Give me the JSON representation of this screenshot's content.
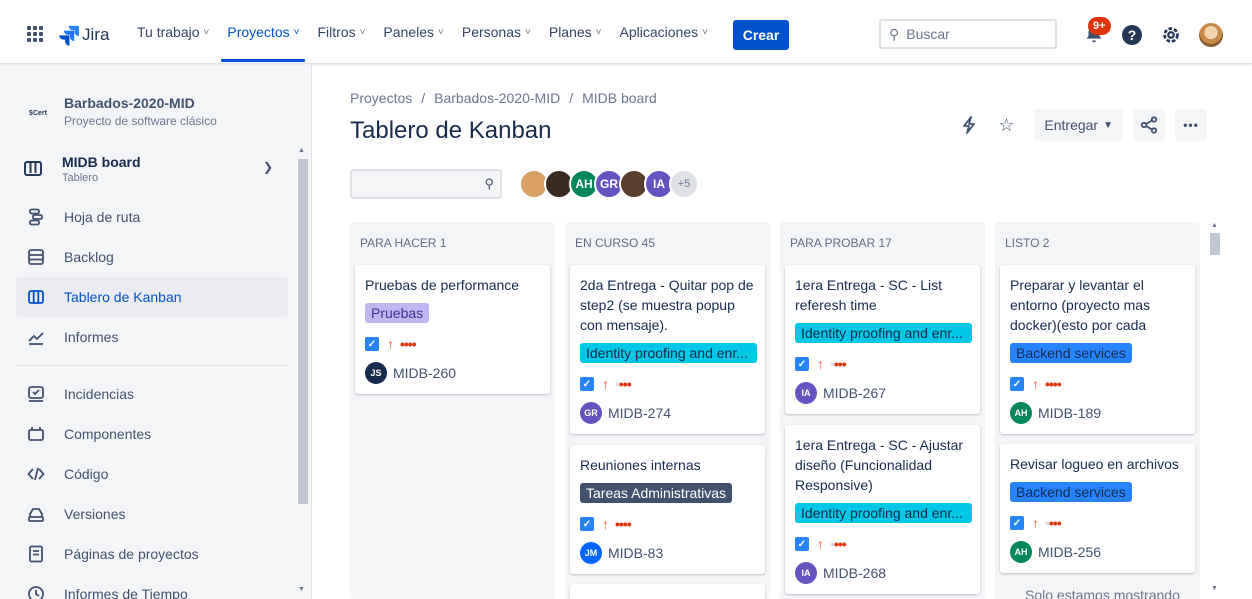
{
  "nav": {
    "logo_text": "Jira",
    "items": [
      {
        "label": "Tu trabajo"
      },
      {
        "label": "Proyectos",
        "active": true
      },
      {
        "label": "Filtros"
      },
      {
        "label": "Paneles"
      },
      {
        "label": "Personas"
      },
      {
        "label": "Planes"
      },
      {
        "label": "Aplicaciones"
      }
    ],
    "create_label": "Crear",
    "search_placeholder": "Buscar",
    "notifications_badge": "9+",
    "help_label": "?"
  },
  "sidebar": {
    "project_logo": "$Cert",
    "project_name": "Barbados-2020-MID",
    "project_type": "Proyecto de software clásico",
    "board_name": "MIDB board",
    "board_type": "Tablero",
    "items_top": [
      {
        "label": "Hoja de ruta",
        "icon": "roadmap-icon"
      },
      {
        "label": "Backlog",
        "icon": "backlog-icon"
      },
      {
        "label": "Tablero de Kanban",
        "icon": "board-icon",
        "active": true
      },
      {
        "label": "Informes",
        "icon": "reports-icon"
      }
    ],
    "items_bottom": [
      {
        "label": "Incidencias",
        "icon": "issues-icon"
      },
      {
        "label": "Componentes",
        "icon": "components-icon"
      },
      {
        "label": "Código",
        "icon": "code-icon"
      },
      {
        "label": "Versiones",
        "icon": "releases-icon"
      },
      {
        "label": "Páginas de proyectos",
        "icon": "pages-icon"
      },
      {
        "label": "Informes de Tiempo",
        "icon": "time-icon"
      }
    ]
  },
  "main": {
    "breadcrumb": [
      "Proyectos",
      "Barbados-2020-MID",
      "MIDB board"
    ],
    "title": "Tablero de Kanban",
    "entregar_label": "Entregar",
    "more_label": "•••",
    "avatars": [
      {
        "initials": "",
        "color": "#d9a066"
      },
      {
        "initials": "",
        "color": "#3b2a20"
      },
      {
        "initials": "AH",
        "color": "#00875a"
      },
      {
        "initials": "GR",
        "color": "#6554c0"
      },
      {
        "initials": "",
        "color": "#5a3d2b"
      },
      {
        "initials": "IA",
        "color": "#6554c0"
      },
      {
        "initials": "+5",
        "color": "#dfe1e6"
      }
    ]
  },
  "board": {
    "columns": [
      {
        "header": "PARA HACER 1",
        "cards": [
          {
            "title": "Pruebas de performance",
            "label": "Pruebas",
            "label_style": "purple",
            "avatar": "JS",
            "avatar_color": "#172b4d",
            "key": "MIDB-260",
            "dots": "full"
          }
        ]
      },
      {
        "header": "EN CURSO 45",
        "cards": [
          {
            "title": "2da Entrega - Quitar pop de step2 (se muestra popup con mensaje).",
            "label": "Identity proofing and enr...",
            "label_style": "cyan",
            "avatar": "GR",
            "avatar_color": "#6554c0",
            "key": "MIDB-274",
            "dots": "partial"
          },
          {
            "title": "Reuniones internas",
            "label": "Tareas Administrativas",
            "label_style": "dark",
            "avatar": "JM",
            "avatar_color": "#0065ff",
            "key": "MIDB-83",
            "dots": "full"
          }
        ]
      },
      {
        "header": "PARA PROBAR 17",
        "cards": [
          {
            "title": "1era Entrega - SC - List referesh time",
            "label": "Identity proofing and enr...",
            "label_style": "cyan",
            "avatar": "IA",
            "avatar_color": "#6554c0",
            "key": "MIDB-267",
            "dots": "partial"
          },
          {
            "title": "1era Entrega - SC - Ajustar diseño (Funcionalidad Responsive)",
            "label": "Identity proofing and enr...",
            "label_style": "cyan",
            "avatar": "IA",
            "avatar_color": "#6554c0",
            "key": "MIDB-268",
            "dots": "partial"
          }
        ]
      },
      {
        "header": "LISTO 2",
        "cards": [
          {
            "title": "Preparar y levantar el entorno (proyecto mas docker)(esto por cada",
            "label": "Backend services",
            "label_style": "blue",
            "avatar": "AH",
            "avatar_color": "#00875a",
            "key": "MIDB-189",
            "dots": "full"
          },
          {
            "title": "Revisar logueo en archivos",
            "label": "Backend services",
            "label_style": "blue",
            "avatar": "AH",
            "avatar_color": "#00875a",
            "key": "MIDB-256",
            "dots": "partial"
          }
        ]
      }
    ],
    "footer_partial": "Solo estamos mostrando"
  },
  "colors": {
    "accent": "#0052cc",
    "sidebar_bg": "#f4f5f7"
  }
}
